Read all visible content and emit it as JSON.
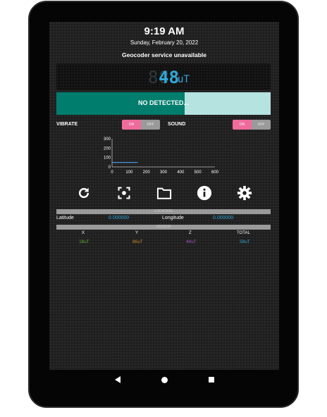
{
  "status": {
    "time": "9:19 AM",
    "date": "Sunday, February 20, 2022",
    "geocoder": "Geocoder service unavailable"
  },
  "reading": {
    "ghost": "888",
    "value": "48",
    "unit": "uT",
    "color": "#31a8d8"
  },
  "detection": {
    "label": "NO DETECTED...",
    "level_fraction": 0.6,
    "fill_color": "#007d6d",
    "track_color": "#b5e3e0"
  },
  "controls": {
    "vibrate_label": "VIBRATE",
    "sound_label": "SOUND",
    "on_label": "ON",
    "off_label": "OFF",
    "vibrate_state": "on",
    "sound_state": "on",
    "accent": "#ef6b9c"
  },
  "chart_data": {
    "type": "line",
    "x_ticks": [
      "0",
      "100",
      "200",
      "300",
      "400",
      "500",
      "600"
    ],
    "y_ticks": [
      "300",
      "200",
      "100",
      "0"
    ],
    "xlim": [
      0,
      600
    ],
    "ylim": [
      0,
      300
    ],
    "series": [
      {
        "x": [
          0,
          150
        ],
        "y": [
          48,
          48
        ]
      }
    ]
  },
  "toolbar": {
    "icons": [
      "refresh-icon",
      "scan-icon",
      "folder-icon",
      "info-icon",
      "settings-icon"
    ]
  },
  "location": {
    "header": "LOCATION",
    "latitude_label": "Latitude",
    "latitude_value": "0.000000",
    "longitude_label": "Longitude",
    "longitude_value": "0.000000"
  },
  "sensor": {
    "header": "SENSOR",
    "columns": [
      "X",
      "Y",
      "Z",
      "TOTAL"
    ],
    "values": [
      {
        "text": "18uT",
        "color": "#5fae3a"
      },
      {
        "text": "86uT",
        "color": "#c8892a"
      },
      {
        "text": "44uT",
        "color": "#a35ac0"
      },
      {
        "text": "58uT",
        "color": "#31a8d8"
      }
    ]
  }
}
